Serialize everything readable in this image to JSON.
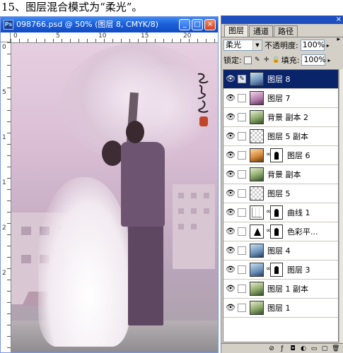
{
  "caption": "15、图层混合模式为“柔光”。",
  "document": {
    "title": "098766.psd @ 50% (图层 8, CMYK/8)",
    "ruler_top": [
      "0",
      "5",
      "10",
      "15",
      "20"
    ],
    "ruler_left": [
      "0",
      "5",
      "1",
      "1",
      "2",
      "2"
    ]
  },
  "panel": {
    "tabs": [
      "图层",
      "通道",
      "路径"
    ],
    "blend_mode": "柔光",
    "opacity_label": "不透明度:",
    "opacity_value": "100%",
    "lock_label": "锁定:",
    "fill_label": "填充:",
    "fill_value": "100%",
    "layers": [
      {
        "name": "图层 8",
        "selected": true,
        "thumb": "photo",
        "mask": false
      },
      {
        "name": "图层 7",
        "selected": false,
        "thumb": "photo-pink",
        "mask": false
      },
      {
        "name": "背景 副本 2",
        "selected": false,
        "thumb": "photo-green",
        "mask": false
      },
      {
        "name": "图层 5 副本",
        "selected": false,
        "thumb": "trans",
        "mask": false
      },
      {
        "name": "图层 6",
        "selected": false,
        "thumb": "photo-warm",
        "mask": true
      },
      {
        "name": "背景 副本",
        "selected": false,
        "thumb": "photo-green",
        "mask": false
      },
      {
        "name": "图层 5",
        "selected": false,
        "thumb": "trans",
        "mask": false
      },
      {
        "name": "曲线 1",
        "selected": false,
        "thumb": "curve",
        "mask": true
      },
      {
        "name": "色彩平...",
        "selected": false,
        "thumb": "balance",
        "mask": true
      },
      {
        "name": "图层 4",
        "selected": false,
        "thumb": "photo",
        "mask": false
      },
      {
        "name": "图层 3",
        "selected": false,
        "thumb": "photo",
        "mask": true
      },
      {
        "name": "图层 1 副本",
        "selected": false,
        "thumb": "photo-green",
        "mask": false
      },
      {
        "name": "图层 1",
        "selected": false,
        "thumb": "photo-green",
        "mask": false
      }
    ]
  }
}
